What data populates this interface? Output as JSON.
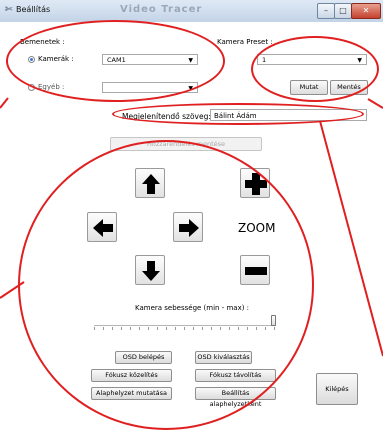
{
  "window": {
    "title": "Beállítás",
    "background_title": "Video Tracer",
    "controls": {
      "minimize": "–",
      "maximize": "□",
      "close": "✕"
    }
  },
  "inputs": {
    "section_label": "Bemenetek :",
    "camera_label": "Kamerák :",
    "camera_value": "CAM1",
    "other_label": "Egyéb :",
    "other_value": ""
  },
  "preset": {
    "section_label": "Kamera Preset :",
    "value": "1",
    "show_button": "Mutat",
    "save_button": "Mentés"
  },
  "display_text": {
    "label": "Megjelenítendő szöveg:",
    "value": "Bálint Ádám"
  },
  "assignment": {
    "save_button": "Hozzárendelés mentése"
  },
  "ptz": {
    "zoom_label": "ZOOM"
  },
  "speed": {
    "label": "Kamera sebessége (min - max) :",
    "value": 1.0
  },
  "actions": {
    "osd_enter": "OSD belépés",
    "osd_select": "OSD kiválasztás",
    "focus_near": "Fókusz közelítés",
    "focus_far": "Fókusz távolítás",
    "show_home": "Alaphelyzet mutatása",
    "set_home": "Beállítás alaphelyzetként",
    "exit": "Kilépés"
  },
  "colors": {
    "annotation": "#e02020",
    "accent": "#3b7bd4"
  }
}
